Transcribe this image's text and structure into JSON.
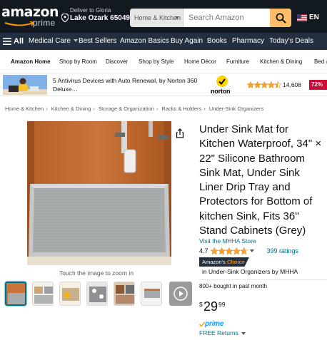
{
  "header": {
    "logo_text": "amazon",
    "logo_sub": "prime",
    "deliver_label": "Deliver to Gloria",
    "deliver_location": "Lake Ozark 65049",
    "search_category": "Home & Kitchen",
    "search_placeholder": "Search Amazon",
    "language": "EN"
  },
  "nav": {
    "all_label": "All",
    "items": [
      "Medical Care",
      "Best Sellers",
      "Amazon Basics",
      "Buy Again",
      "Books",
      "Pharmacy",
      "Today's Deals"
    ]
  },
  "subnav": {
    "items": [
      "Amazon Home",
      "Shop by Room",
      "Discover",
      "Shop by Style",
      "Home Décor",
      "Furniture",
      "Kitchen & Dining",
      "Bed & Bath"
    ]
  },
  "ad": {
    "text": "5 Antivirus Devices with Auto Renewal, by Norton 360 Deluxe…",
    "brand": "norton",
    "rating": 4.5,
    "review_count": "14,608",
    "discount": "72%"
  },
  "breadcrumb": [
    "Home & Kitchen",
    "Kitchen & Dining",
    "Storage & Organization",
    "Racks & Holders",
    "Under-Sink Organizers"
  ],
  "gallery": {
    "zoom_hint": "Touch the image to zoom in",
    "thumbnail_count": 8,
    "selected_index": 0
  },
  "product": {
    "title": "Under Sink Mat for Kitchen Waterproof, 34\" × 22\" Silicone Bathroom Sink Mat, Under Sink Liner Drip Tray and Protectors for Bottom of kitchen Sink, Fits 36'' Stand Cabinets (Grey)",
    "store_link": "Visit the MHHA Store",
    "rating": "4.7",
    "rating_count": "399 ratings",
    "choice_prefix": "Amazon's",
    "choice_word": "Choice",
    "choice_category": "in Under-Sink Organizers by MHHA",
    "bought": "800+ bought in past month",
    "price_symbol": "$",
    "price_whole": "29",
    "price_fraction": "99",
    "prime_label": "prime",
    "returns": "FREE Returns"
  },
  "colors": {
    "nav_dark": "#131921",
    "nav_secondary": "#232f3e",
    "search_button": "#febd69",
    "link": "#007185",
    "star": "#ffa41c",
    "prime_blue": "#1399ff",
    "choice_orange": "#f08804",
    "deal_red": "#cc0c39"
  }
}
